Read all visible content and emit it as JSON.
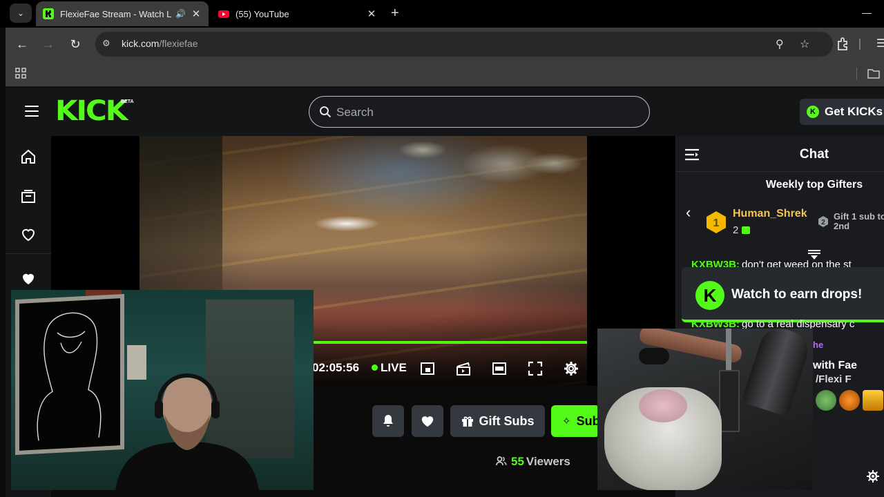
{
  "browser": {
    "tabs": [
      {
        "title": "FlexieFae Stream - Watch Live",
        "active": true,
        "audio": true
      },
      {
        "title": "(55) YouTube",
        "active": false
      }
    ],
    "url_host": "kick.com",
    "url_path": "/flexiefae"
  },
  "header": {
    "logo": "KICK",
    "beta": "BETA",
    "search_placeholder": "Search",
    "get_kicks": "Get KICKs"
  },
  "player": {
    "timecode": "02:05:56",
    "live": "LIVE",
    "progress": 1.0
  },
  "chat": {
    "title": "Chat",
    "gifters_title": "Weekly top Gifters",
    "top_gifter": {
      "rank": "1",
      "name": "Human_Shrek",
      "count": "2"
    },
    "second": {
      "rank": "2",
      "label": "Gift 1 sub to",
      "label2": "2nd"
    },
    "messages": [
      {
        "user": "KXBW3B:",
        "text": "don't get weed on the st"
      },
      {
        "user": "KXBW3B:",
        "text": "go to a real dispensary c"
      }
    ],
    "drops_banner": "Watch to earn drops!",
    "peek_user": "he",
    "peek_text": "with Fae",
    "peek_text2": "/Flexi F"
  },
  "actions": {
    "gift_subs": "Gift Subs",
    "subscribe": "Sub",
    "viewer_count": "55",
    "viewers_label": "Viewers"
  },
  "colors": {
    "brand": "#53fc18",
    "gifter_gold": "#f5c451",
    "surface": "#191b1f"
  }
}
